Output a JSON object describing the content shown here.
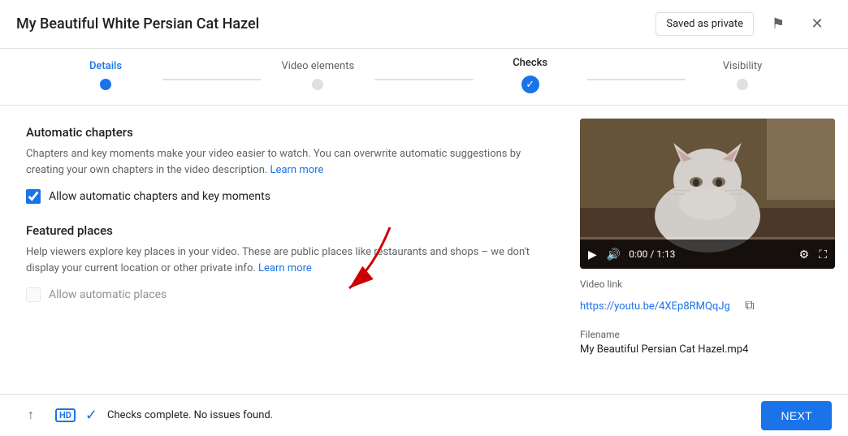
{
  "header": {
    "title": "My Beautiful White Persian Cat Hazel",
    "saved_badge": "Saved as private",
    "flag_icon": "⚑",
    "close_icon": "✕"
  },
  "steps": [
    {
      "id": "details",
      "label": "Details",
      "state": "active"
    },
    {
      "id": "video_elements",
      "label": "Video elements",
      "state": "inactive"
    },
    {
      "id": "checks",
      "label": "Checks",
      "state": "completed"
    },
    {
      "id": "visibility",
      "label": "Visibility",
      "state": "inactive"
    }
  ],
  "automatic_chapters": {
    "title": "Automatic chapters",
    "description": "Chapters and key moments make your video easier to watch. You can overwrite automatic suggestions by creating your own chapters in the video description.",
    "learn_more": "Learn more",
    "checkbox_label": "Allow automatic chapters and key moments",
    "checked": true
  },
  "featured_places": {
    "title": "Featured places",
    "description": "Help viewers explore key places in your video. These are public places like restaurants and shops – we don't display your current location or other private info.",
    "learn_more": "Learn more",
    "checkbox_label": "Allow automatic places",
    "checked": false,
    "disabled": true
  },
  "video_panel": {
    "video_link_label": "Video link",
    "video_url": "https://youtu.be/4XEp8RMQqJg",
    "copy_icon": "⧉",
    "time": "0:00 / 1:13",
    "filename_label": "Filename",
    "filename": "My Beautiful Persian Cat Hazel.mp4"
  },
  "footer": {
    "upload_icon": "↑",
    "hd_label": "HD",
    "status": "Checks complete. No issues found.",
    "next_label": "NEXT"
  }
}
